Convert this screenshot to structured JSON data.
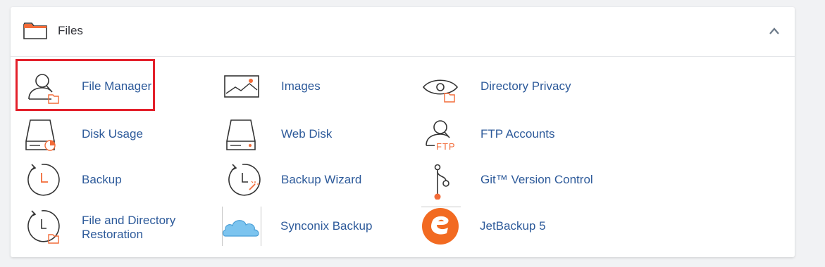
{
  "section": {
    "title": "Files",
    "icon": "folder-icon",
    "collapse_icon": "chevron-up-icon"
  },
  "items": [
    {
      "label": "File Manager",
      "icon": "file-manager-icon"
    },
    {
      "label": "Images",
      "icon": "image-icon"
    },
    {
      "label": "Directory Privacy",
      "icon": "eye-folder-icon"
    },
    {
      "label": "Disk Usage",
      "icon": "disk-usage-icon"
    },
    {
      "label": "Web Disk",
      "icon": "hard-drive-icon"
    },
    {
      "label": "FTP Accounts",
      "icon": "ftp-user-icon"
    },
    {
      "label": "Backup",
      "icon": "backup-clock-icon"
    },
    {
      "label": "Backup Wizard",
      "icon": "backup-wizard-icon"
    },
    {
      "label": "Git™ Version Control",
      "icon": "git-branch-icon"
    },
    {
      "label": "File and Directory Restoration",
      "icon": "restore-icon"
    },
    {
      "label": "Synconix Backup",
      "icon": "cloud-icon"
    },
    {
      "label": "JetBackup 5",
      "icon": "jetbackup-logo-icon"
    }
  ],
  "highlighted_item": "File Manager",
  "colors": {
    "link": "#2d5a9a",
    "accent_orange": "#f26b38",
    "highlight_border": "#e3202b",
    "cloud_blue": "#7cc4ef",
    "jetbackup_orange": "#f26a21"
  }
}
